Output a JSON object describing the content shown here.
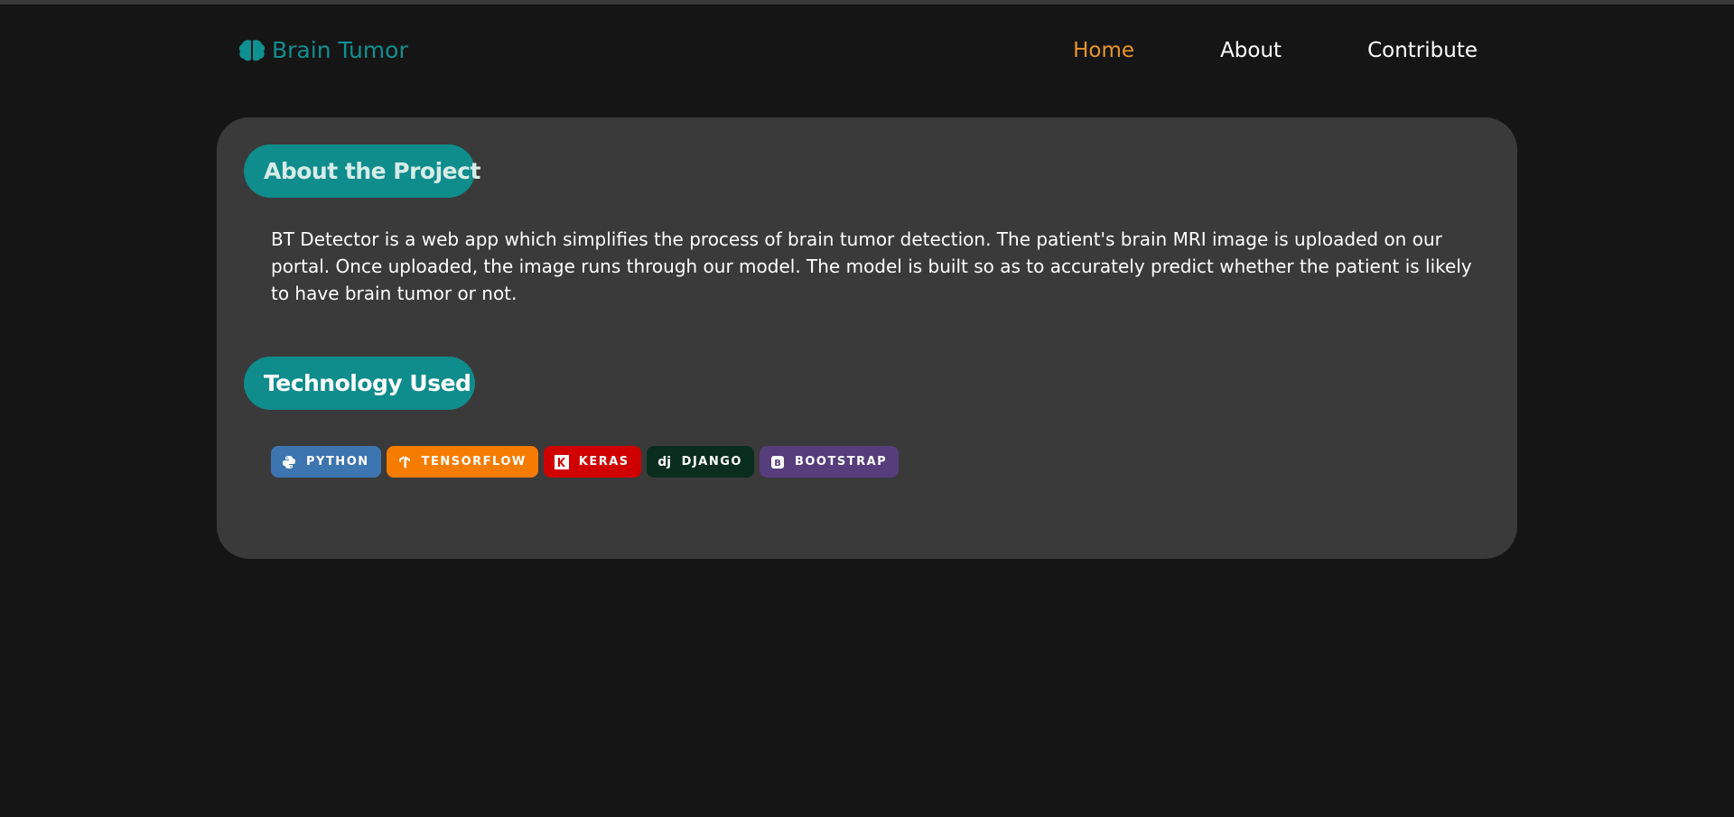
{
  "navbar": {
    "brand": "Brain Tumor",
    "links": [
      {
        "label": "Home",
        "active": true
      },
      {
        "label": "About",
        "active": false
      },
      {
        "label": "Contribute",
        "active": false
      }
    ]
  },
  "about": {
    "heading": "About the Project",
    "text": "BT Detector is a web app which simplifies the process of brain tumor detection. The patient's brain MRI image is uploaded on our portal. Once uploaded, the image runs through our model. The model is built so as to accurately predict whether the patient is likely to have brain tumor or not."
  },
  "technology": {
    "heading": "Technology Used",
    "badges": [
      {
        "label": "PYTHON",
        "icon": "python-icon",
        "color": "#3d75b0"
      },
      {
        "label": "TENSORFLOW",
        "icon": "tensorflow-icon",
        "color": "#f57c00"
      },
      {
        "label": "KERAS",
        "icon": "keras-icon",
        "color": "#d00000"
      },
      {
        "label": "DJANGO",
        "icon": "django-icon",
        "color": "#092e20"
      },
      {
        "label": "BOOTSTRAP",
        "icon": "bootstrap-icon",
        "color": "#563d7c"
      }
    ]
  },
  "colors": {
    "background": "#151515",
    "card": "#3a3a3a",
    "accent": "#0f8c8c",
    "active_link": "#e8962a"
  }
}
